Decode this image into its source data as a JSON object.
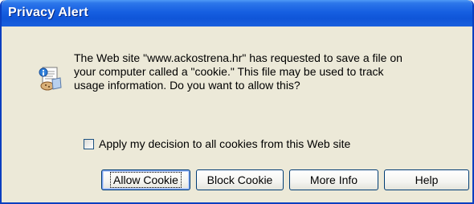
{
  "window": {
    "title": "Privacy Alert"
  },
  "dialog": {
    "icon": "privacy-cookie-icon",
    "message_lines": [
      "The Web site \"www.ackostrena.hr\" has requested to save a file on",
      "your computer called a \"cookie.\"  This file may be used to track",
      "usage information. Do you want to allow this?"
    ],
    "checkbox": {
      "label": "Apply my decision to all cookies from this Web site",
      "checked": false
    }
  },
  "buttons": {
    "allow": "Allow Cookie",
    "block": "Block Cookie",
    "more_info": "More Info",
    "help": "Help"
  },
  "colors": {
    "title_bar": "#0f55d8",
    "dialog_bg": "#ece9d8",
    "button_border": "#003c74"
  }
}
